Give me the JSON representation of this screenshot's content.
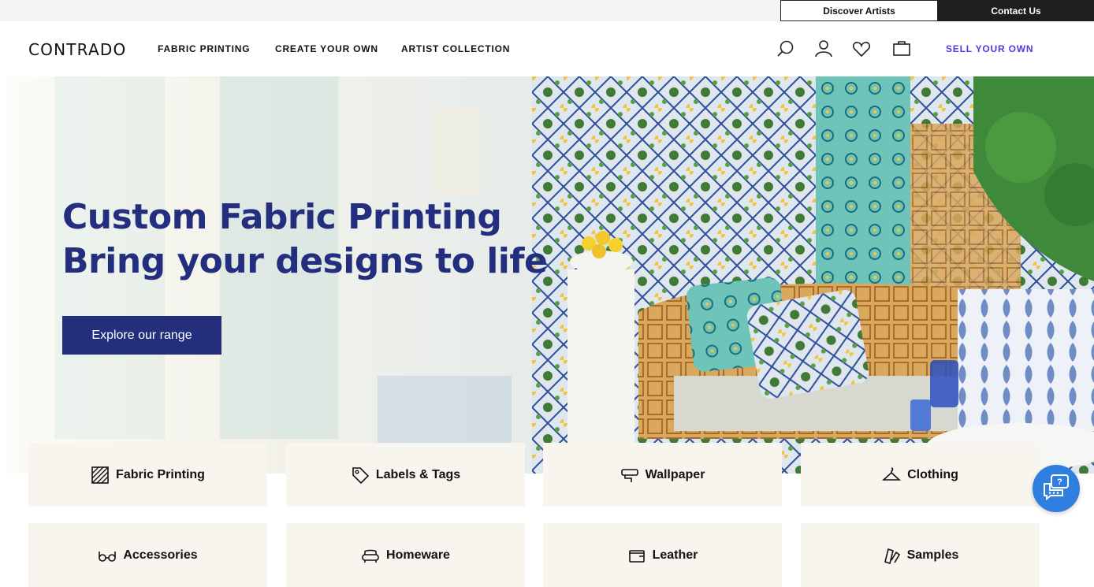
{
  "topbar": {
    "discover_label": "Discover Artists",
    "contact_label": "Contact Us"
  },
  "header": {
    "logo": "CONTRADO",
    "nav": [
      {
        "label": "FABRIC PRINTING"
      },
      {
        "label": "CREATE YOUR OWN"
      },
      {
        "label": "ARTIST COLLECTION"
      }
    ],
    "icons": [
      "search-icon",
      "account-icon",
      "heart-icon",
      "bag-icon"
    ],
    "sell_label": "SELL YOUR OWN",
    "sell_color": "#4a3ce0"
  },
  "hero": {
    "title_line1": "Custom Fabric Printing",
    "title_line2": "Bring your designs to life",
    "cta_label": "Explore our range",
    "title_color": "#242e7e",
    "cta_color": "#232f7c"
  },
  "categories": [
    {
      "label": "Fabric Printing",
      "icon": "fabric-icon"
    },
    {
      "label": "Labels & Tags",
      "icon": "tag-icon"
    },
    {
      "label": "Wallpaper",
      "icon": "wallpaper-roller-icon"
    },
    {
      "label": "Clothing",
      "icon": "hanger-icon"
    },
    {
      "label": "Accessories",
      "icon": "glasses-icon"
    },
    {
      "label": "Homeware",
      "icon": "sofa-icon"
    },
    {
      "label": "Leather",
      "icon": "wallet-icon"
    },
    {
      "label": "Samples",
      "icon": "samples-icon"
    }
  ],
  "chat": {
    "icon": "chat-help-icon",
    "color": "#2f7fe0"
  }
}
